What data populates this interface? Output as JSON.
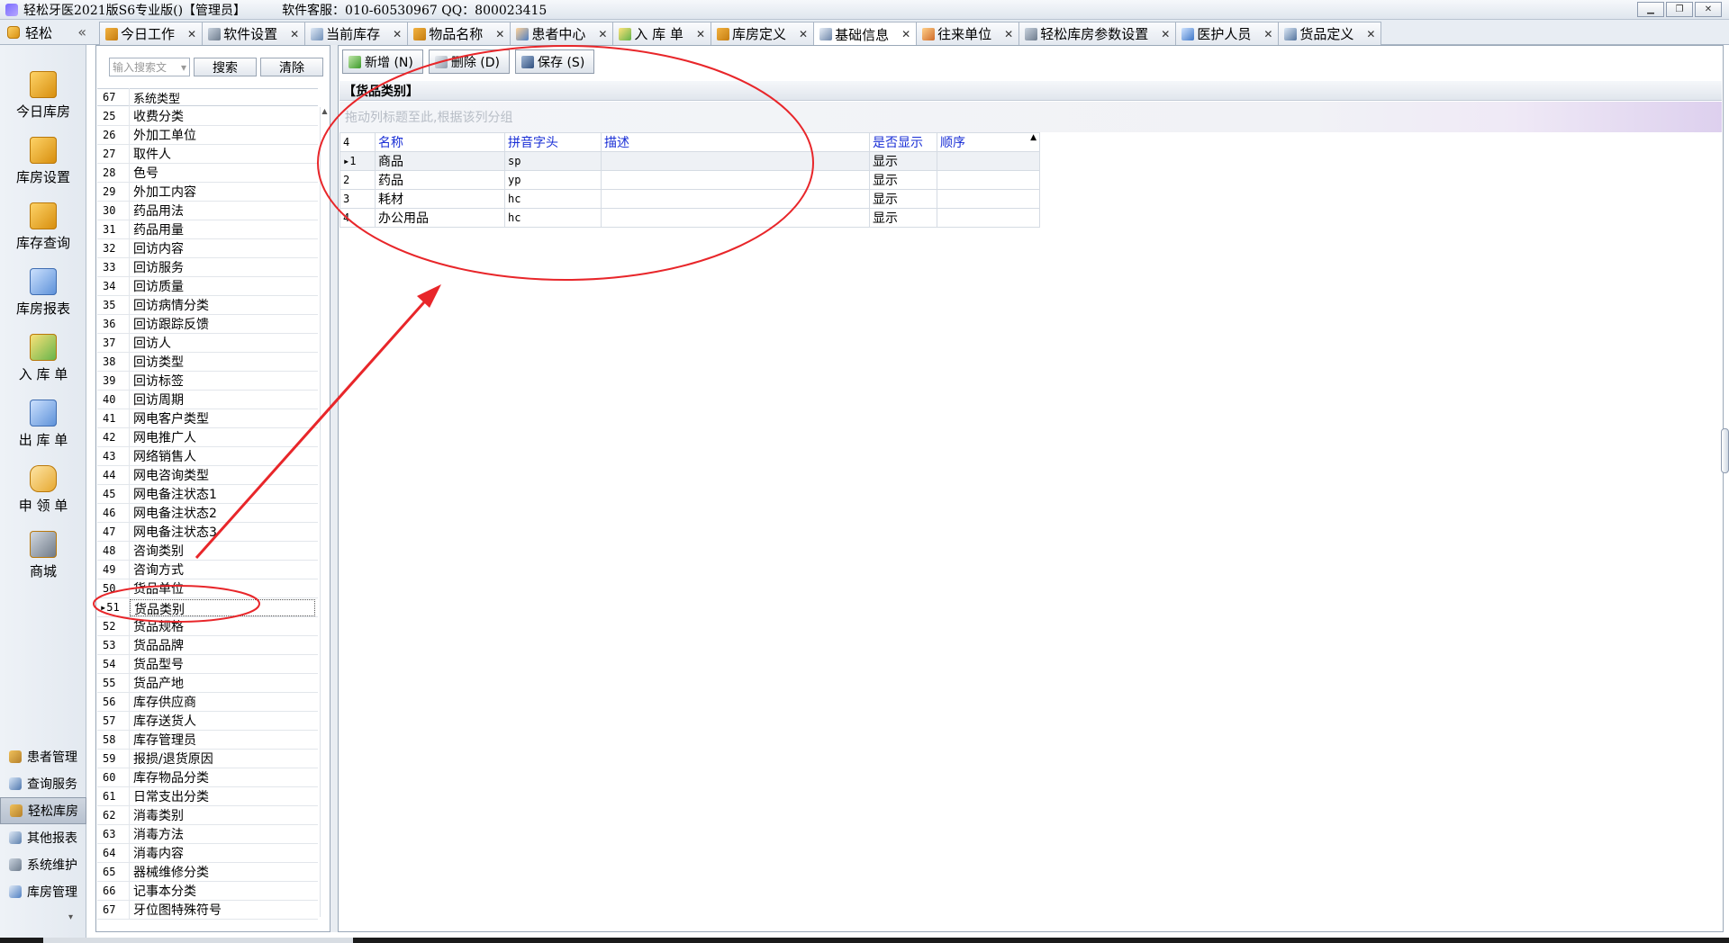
{
  "window": {
    "title": "轻松牙医2021版S6专业版()【管理员】",
    "support": "软件客服：010-60530967 QQ：800023415"
  },
  "nav": {
    "label": "轻松",
    "collapse": "«"
  },
  "tabs": [
    {
      "label": "今日工作"
    },
    {
      "label": "软件设置"
    },
    {
      "label": "当前库存"
    },
    {
      "label": "物品名称"
    },
    {
      "label": "患者中心"
    },
    {
      "label": "入 库 单"
    },
    {
      "label": "库房定义"
    },
    {
      "label": "基础信息"
    },
    {
      "label": "往来单位"
    },
    {
      "label": "轻松库房参数设置"
    },
    {
      "label": "医护人员"
    },
    {
      "label": "货品定义"
    }
  ],
  "sidebar": {
    "items": [
      {
        "label": "今日库房"
      },
      {
        "label": "库房设置"
      },
      {
        "label": "库存查询"
      },
      {
        "label": "库房报表"
      },
      {
        "label": "入 库 单"
      },
      {
        "label": "出 库 单"
      },
      {
        "label": "申 领 单"
      },
      {
        "label": "商城"
      }
    ],
    "bottom": [
      {
        "label": "患者管理"
      },
      {
        "label": "查询服务"
      },
      {
        "label": "轻松库房"
      },
      {
        "label": "其他报表"
      },
      {
        "label": "系统维护"
      },
      {
        "label": "库房管理"
      }
    ]
  },
  "list": {
    "search_placeholder": "输入搜索文",
    "search_btn": "搜索",
    "clear_btn": "清除",
    "header_num": "67",
    "header_name": "系统类型",
    "rows": [
      {
        "num": "25",
        "name": "收费分类"
      },
      {
        "num": "26",
        "name": "外加工单位"
      },
      {
        "num": "27",
        "name": "取件人"
      },
      {
        "num": "28",
        "name": "色号"
      },
      {
        "num": "29",
        "name": "外加工内容"
      },
      {
        "num": "30",
        "name": "药品用法"
      },
      {
        "num": "31",
        "name": "药品用量"
      },
      {
        "num": "32",
        "name": "回访内容"
      },
      {
        "num": "33",
        "name": "回访服务"
      },
      {
        "num": "34",
        "name": "回访质量"
      },
      {
        "num": "35",
        "name": "回访病情分类"
      },
      {
        "num": "36",
        "name": "回访跟踪反馈"
      },
      {
        "num": "37",
        "name": "回访人"
      },
      {
        "num": "38",
        "name": "回访类型"
      },
      {
        "num": "39",
        "name": "回访标签"
      },
      {
        "num": "40",
        "name": "回访周期"
      },
      {
        "num": "41",
        "name": "网电客户类型"
      },
      {
        "num": "42",
        "name": "网电推广人"
      },
      {
        "num": "43",
        "name": "网络销售人"
      },
      {
        "num": "44",
        "name": "网电咨询类型"
      },
      {
        "num": "45",
        "name": "网电备注状态1"
      },
      {
        "num": "46",
        "name": "网电备注状态2"
      },
      {
        "num": "47",
        "name": "网电备注状态3"
      },
      {
        "num": "48",
        "name": "咨询类别"
      },
      {
        "num": "49",
        "name": "咨询方式"
      },
      {
        "num": "50",
        "name": "货品单位"
      },
      {
        "num": "51",
        "name": "货品类别"
      },
      {
        "num": "52",
        "name": "货品规格"
      },
      {
        "num": "53",
        "name": "货品品牌"
      },
      {
        "num": "54",
        "name": "货品型号"
      },
      {
        "num": "55",
        "name": "货品产地"
      },
      {
        "num": "56",
        "name": "库存供应商"
      },
      {
        "num": "57",
        "name": "库存送货人"
      },
      {
        "num": "58",
        "name": "库存管理员"
      },
      {
        "num": "59",
        "name": "报损/退货原因"
      },
      {
        "num": "60",
        "name": "库存物品分类"
      },
      {
        "num": "61",
        "name": "日常支出分类"
      },
      {
        "num": "62",
        "name": "消毒类别"
      },
      {
        "num": "63",
        "name": "消毒方法"
      },
      {
        "num": "64",
        "name": "消毒内容"
      },
      {
        "num": "65",
        "name": "器械维修分类"
      },
      {
        "num": "66",
        "name": "记事本分类"
      },
      {
        "num": "67",
        "name": "牙位图特殊符号"
      }
    ]
  },
  "toolbar": {
    "add": "新增 (N)",
    "delete": "删除 (D)",
    "save": "保存 (S)"
  },
  "detail": {
    "section_title": "【货品类别】",
    "group_hint": "拖动列标题至此,根据该列分组",
    "columns": {
      "count": "4",
      "name": "名称",
      "pinyin": "拼音字头",
      "desc": "描述",
      "show": "是否显示",
      "order": "顺序"
    },
    "rows": [
      {
        "idx": "1",
        "name": "商品",
        "pinyin": "sp",
        "desc": "",
        "show": "显示",
        "order": ""
      },
      {
        "idx": "2",
        "name": "药品",
        "pinyin": "yp",
        "desc": "",
        "show": "显示",
        "order": ""
      },
      {
        "idx": "3",
        "name": "耗材",
        "pinyin": "hc",
        "desc": "",
        "show": "显示",
        "order": ""
      },
      {
        "idx": "4",
        "name": "办公用品",
        "pinyin": "hc",
        "desc": "",
        "show": "显示",
        "order": ""
      }
    ]
  },
  "colors": {
    "annotation": "#e8262a",
    "header_text": "#1a2fd6"
  }
}
